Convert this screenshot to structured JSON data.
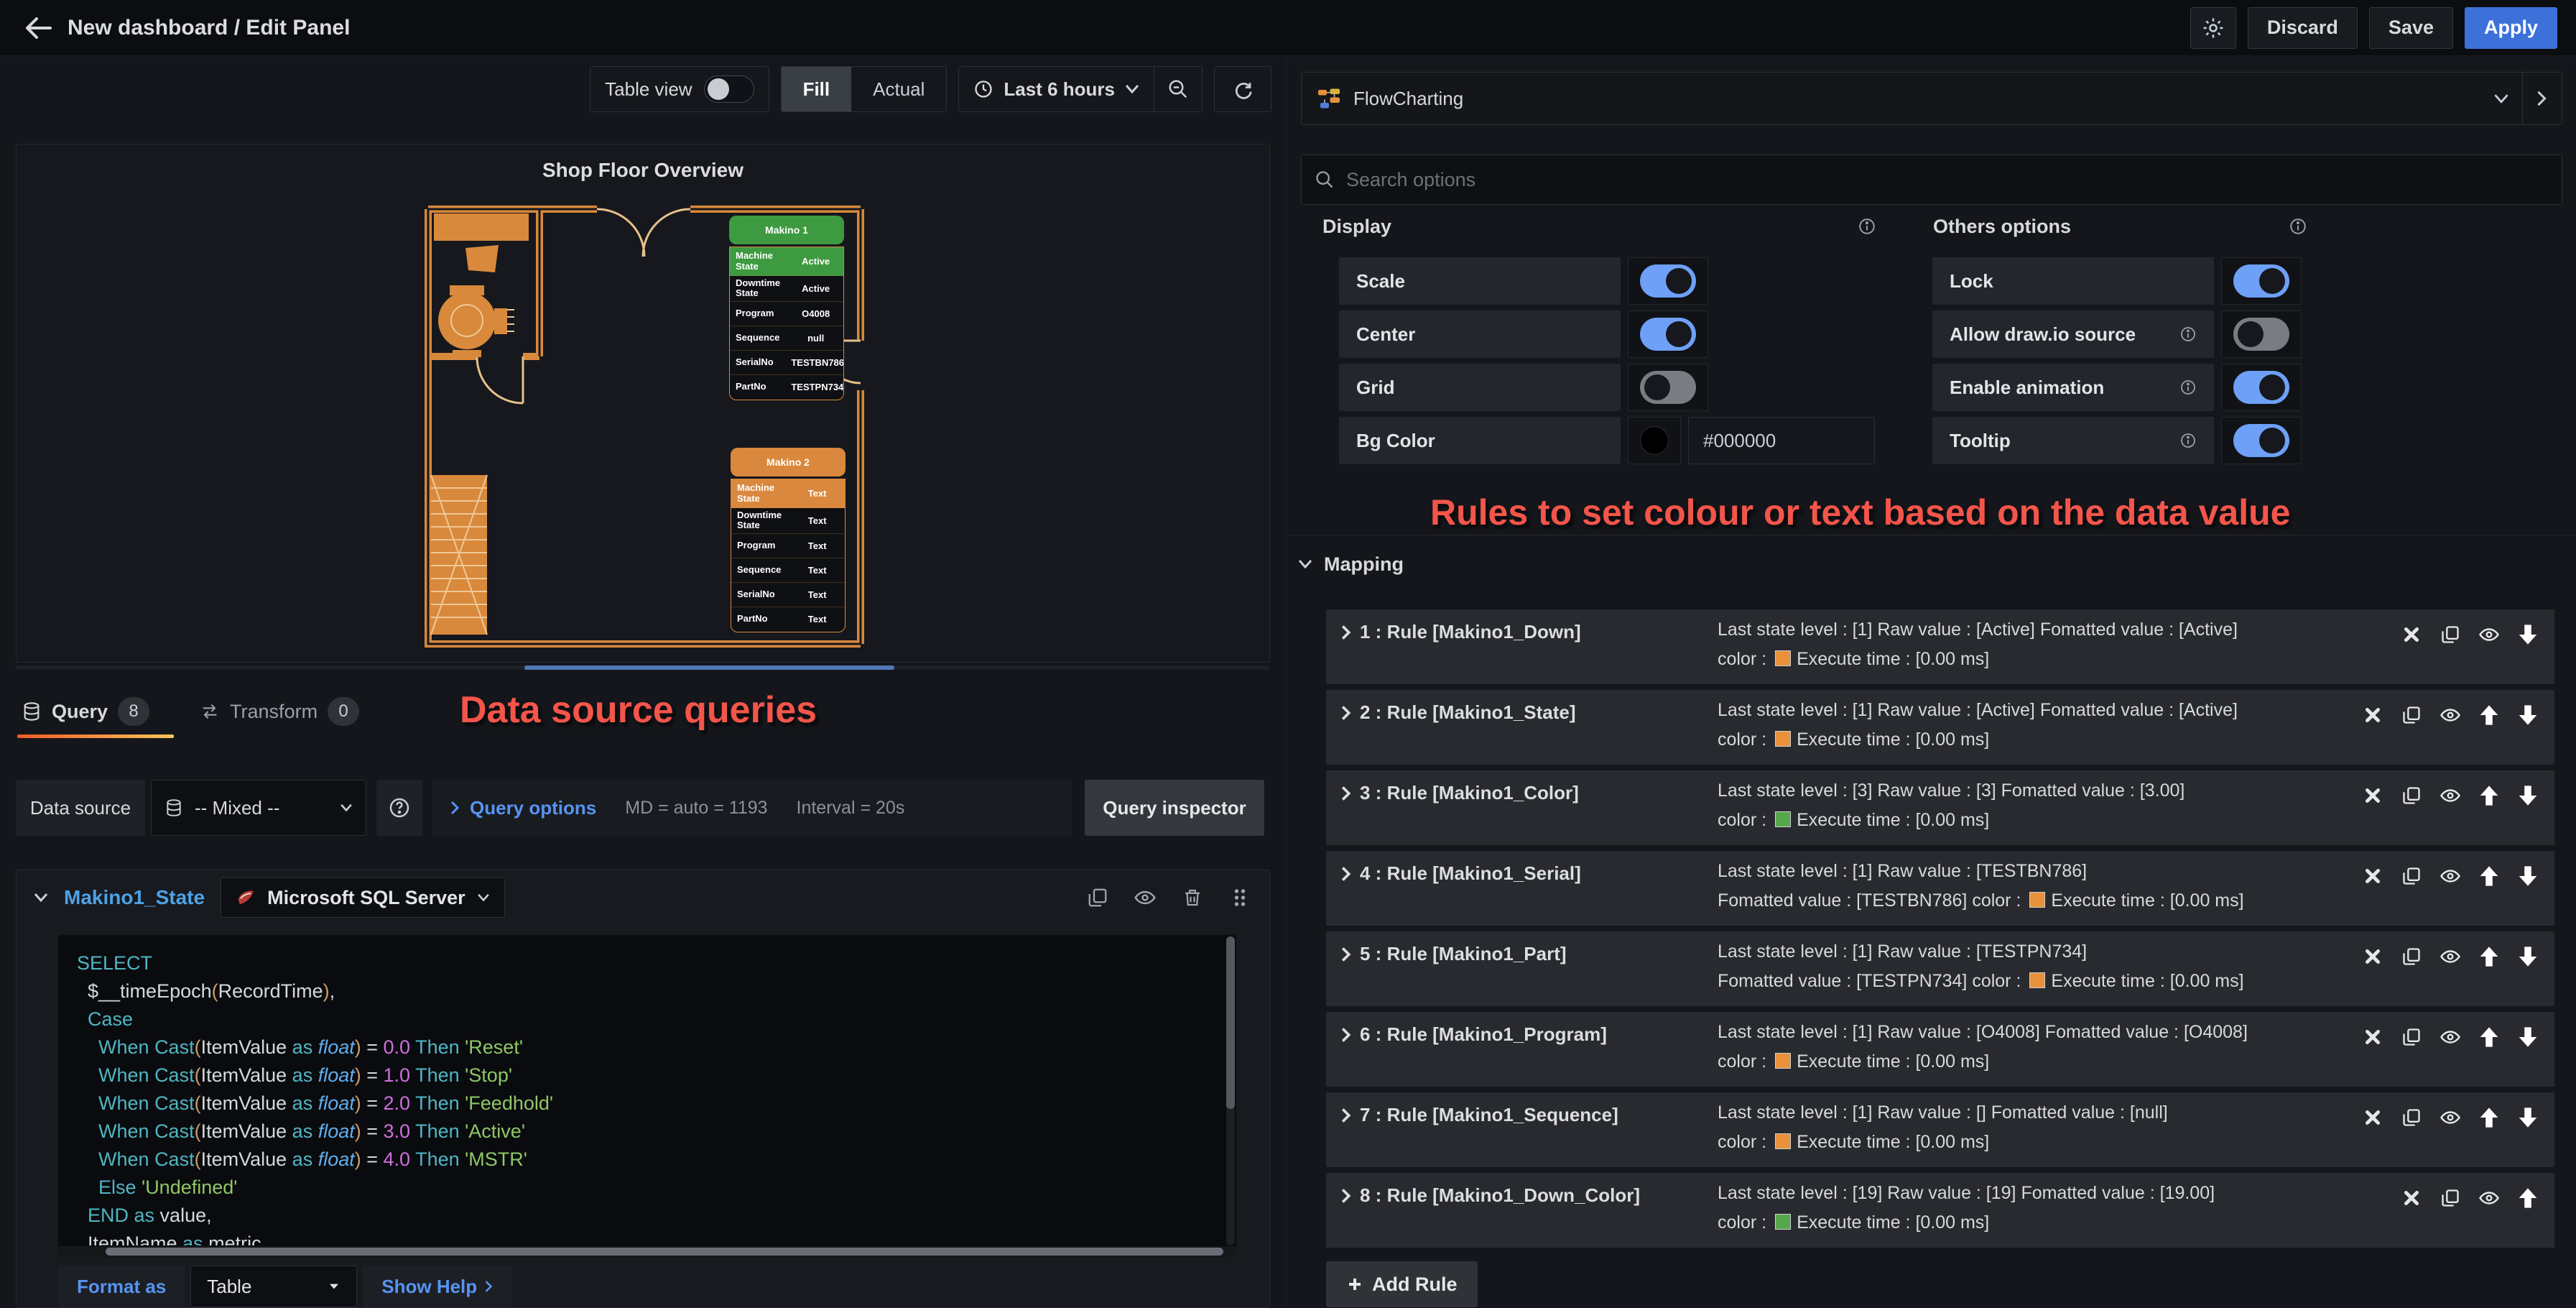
{
  "colors": {
    "blue_accent": "#5794f2",
    "apply_blue": "#3d71d9",
    "toggle_on": "#6ea0f7",
    "wall_orange": "#d9893b",
    "rule_orange": "#e8913a",
    "rule_green": "#56a64b",
    "annotation_red": "#f4554a",
    "machine1_header": "#3d9a40",
    "machine2_header": "#d9883d",
    "bg_color_value": "#000000"
  },
  "topbar": {
    "title": "New dashboard / Edit Panel",
    "discard": "Discard",
    "save": "Save",
    "apply": "Apply"
  },
  "toolbar": {
    "table_view": "Table view",
    "fill": "Fill",
    "actual": "Actual",
    "time_range": "Last 6 hours"
  },
  "panel": {
    "title": "Shop Floor Overview",
    "machine1": {
      "title": "Makino 1",
      "header_color": "#3d9a40",
      "rows": [
        {
          "label": "Machine State",
          "value": "Active"
        },
        {
          "label": "Downtime State",
          "value": "Active"
        },
        {
          "label": "Program",
          "value": "O4008"
        },
        {
          "label": "Sequence",
          "value": "null"
        },
        {
          "label": "SerialNo",
          "value": "TESTBN786"
        },
        {
          "label": "PartNo",
          "value": "TESTPN734"
        }
      ]
    },
    "machine2": {
      "title": "Makino 2",
      "header_color": "#d9883d",
      "rows": [
        {
          "label": "Machine State",
          "value": "Text"
        },
        {
          "label": "Downtime State",
          "value": "Text"
        },
        {
          "label": "Program",
          "value": "Text"
        },
        {
          "label": "Sequence",
          "value": "Text"
        },
        {
          "label": "SerialNo",
          "value": "Text"
        },
        {
          "label": "PartNo",
          "value": "Text"
        }
      ]
    }
  },
  "annotations": {
    "queries": "Data source queries",
    "rules": "Rules to set colour or text based on the data value"
  },
  "tabs": {
    "query": "Query",
    "query_count": "8",
    "transform": "Transform",
    "transform_count": "0"
  },
  "datasource_row": {
    "label": "Data source",
    "value": "-- Mixed --",
    "query_options": "Query options",
    "md": "MD = auto = 1193",
    "interval": "Interval = 20s",
    "inspector": "Query inspector"
  },
  "query_editor": {
    "ref_name": "Makino1_State",
    "datasource": "Microsoft SQL Server",
    "format_as": "Format as",
    "format_value": "Table",
    "show_help": "Show Help",
    "code_lines": [
      [
        [
          "kw",
          "SELECT"
        ]
      ],
      [
        [
          "pl",
          "  $__timeEpoch"
        ],
        [
          "pa",
          "("
        ],
        [
          "pl",
          "RecordTime"
        ],
        [
          "pa",
          ")"
        ],
        [
          "pl",
          ","
        ]
      ],
      [
        [
          "kw",
          "  Case"
        ]
      ],
      [
        [
          "kw",
          "    When"
        ],
        [
          "pl",
          " "
        ],
        [
          "kw",
          "Cast"
        ],
        [
          "pa",
          "("
        ],
        [
          "pl",
          "ItemValue "
        ],
        [
          "kw",
          "as"
        ],
        [
          "ty",
          " float"
        ],
        [
          "pa",
          ")"
        ],
        [
          "pl",
          " = "
        ],
        [
          "nu",
          "0.0"
        ],
        [
          "kw",
          " Then"
        ],
        [
          "st",
          " 'Reset'"
        ]
      ],
      [
        [
          "kw",
          "    When"
        ],
        [
          "pl",
          " "
        ],
        [
          "kw",
          "Cast"
        ],
        [
          "pa",
          "("
        ],
        [
          "pl",
          "ItemValue "
        ],
        [
          "kw",
          "as"
        ],
        [
          "ty",
          " float"
        ],
        [
          "pa",
          ")"
        ],
        [
          "pl",
          " = "
        ],
        [
          "nu",
          "1.0"
        ],
        [
          "kw",
          " Then"
        ],
        [
          "st",
          " 'Stop'"
        ]
      ],
      [
        [
          "kw",
          "    When"
        ],
        [
          "pl",
          " "
        ],
        [
          "kw",
          "Cast"
        ],
        [
          "pa",
          "("
        ],
        [
          "pl",
          "ItemValue "
        ],
        [
          "kw",
          "as"
        ],
        [
          "ty",
          " float"
        ],
        [
          "pa",
          ")"
        ],
        [
          "pl",
          " = "
        ],
        [
          "nu",
          "2.0"
        ],
        [
          "kw",
          " Then"
        ],
        [
          "st",
          " 'Feedhold'"
        ]
      ],
      [
        [
          "kw",
          "    When"
        ],
        [
          "pl",
          " "
        ],
        [
          "kw",
          "Cast"
        ],
        [
          "pa",
          "("
        ],
        [
          "pl",
          "ItemValue "
        ],
        [
          "kw",
          "as"
        ],
        [
          "ty",
          " float"
        ],
        [
          "pa",
          ")"
        ],
        [
          "pl",
          " = "
        ],
        [
          "nu",
          "3.0"
        ],
        [
          "kw",
          " Then"
        ],
        [
          "st",
          " 'Active'"
        ]
      ],
      [
        [
          "kw",
          "    When"
        ],
        [
          "pl",
          " "
        ],
        [
          "kw",
          "Cast"
        ],
        [
          "pa",
          "("
        ],
        [
          "pl",
          "ItemValue "
        ],
        [
          "kw",
          "as"
        ],
        [
          "ty",
          " float"
        ],
        [
          "pa",
          ")"
        ],
        [
          "pl",
          " = "
        ],
        [
          "nu",
          "4.0"
        ],
        [
          "kw",
          " Then"
        ],
        [
          "st",
          " 'MSTR'"
        ]
      ],
      [
        [
          "kw",
          "    Else"
        ],
        [
          "st",
          " 'Undefined'"
        ]
      ],
      [
        [
          "kw",
          "  END"
        ],
        [
          "kw",
          " as"
        ],
        [
          "pl",
          " value,"
        ]
      ],
      [
        [
          "pl",
          "  ItemName "
        ],
        [
          "kw",
          "as"
        ],
        [
          "pl",
          " metric,"
        ]
      ]
    ]
  },
  "options": {
    "viz_name": "FlowCharting",
    "search_placeholder": "Search options",
    "display": {
      "title": "Display",
      "rows": [
        {
          "label": "Scale",
          "type": "toggle",
          "on": true
        },
        {
          "label": "Center",
          "type": "toggle",
          "on": true
        },
        {
          "label": "Grid",
          "type": "toggle",
          "on": false
        },
        {
          "label": "Bg Color",
          "type": "color",
          "value": "#000000"
        }
      ]
    },
    "others": {
      "title": "Others options",
      "rows": [
        {
          "label": "Lock",
          "type": "toggle",
          "on": true,
          "info": false
        },
        {
          "label": "Allow draw.io source",
          "type": "toggle",
          "on": false,
          "info": true
        },
        {
          "label": "Enable animation",
          "type": "toggle",
          "on": true,
          "info": true
        },
        {
          "label": "Tooltip",
          "type": "toggle",
          "on": true,
          "info": true
        }
      ]
    }
  },
  "mapping": {
    "title": "Mapping",
    "add_rule": "Add Rule",
    "rules": [
      {
        "title": "1 : Rule [Makino1_Down]",
        "line1": "Last state level : [1]  Raw value : [Active]  Fomatted value : [Active]",
        "pre": "color :",
        "color": "#e8913a",
        "post": "Execute time : [0.00 ms]",
        "up": false,
        "down": true
      },
      {
        "title": "2 : Rule [Makino1_State]",
        "line1": "Last state level : [1]  Raw value : [Active]  Fomatted value : [Active]",
        "pre": "color :",
        "color": "#e8913a",
        "post": "Execute time : [0.00 ms]",
        "up": true,
        "down": true
      },
      {
        "title": "3 : Rule [Makino1_Color]",
        "line1": "Last state level : [3]  Raw value : [3]  Fomatted value : [3.00]",
        "pre": "color :",
        "color": "#56a64b",
        "post": "Execute time : [0.00 ms]",
        "up": true,
        "down": true
      },
      {
        "title": "4 : Rule [Makino1_Serial]",
        "line1": "Last state level : [1]  Raw value : [TESTBN786]",
        "pre": "Fomatted value : [TESTBN786]  color :",
        "color": "#e8913a",
        "post": "Execute time : [0.00 ms]",
        "up": true,
        "down": true
      },
      {
        "title": "5 : Rule [Makino1_Part]",
        "line1": "Last state level : [1]  Raw value : [TESTPN734]",
        "pre": "Fomatted value : [TESTPN734]  color :",
        "color": "#e8913a",
        "post": "Execute time : [0.00 ms]",
        "up": true,
        "down": true
      },
      {
        "title": "6 : Rule [Makino1_Program]",
        "line1": "Last state level : [1]  Raw value : [O4008]  Fomatted value : [O4008]",
        "pre": "color :",
        "color": "#e8913a",
        "post": "Execute time : [0.00 ms]",
        "up": true,
        "down": true
      },
      {
        "title": "7 : Rule [Makino1_Sequence]",
        "line1": "Last state level : [1]  Raw value : []  Fomatted value : [null]",
        "pre": "color :",
        "color": "#e8913a",
        "post": "Execute time : [0.00 ms]",
        "up": true,
        "down": true
      },
      {
        "title": "8 : Rule [Makino1_Down_Color]",
        "line1": "Last state level : [19]  Raw value : [19]  Fomatted value : [19.00]",
        "pre": "color :",
        "color": "#56a64b",
        "post": "Execute time : [0.00 ms]",
        "up": true,
        "down": false
      }
    ]
  }
}
